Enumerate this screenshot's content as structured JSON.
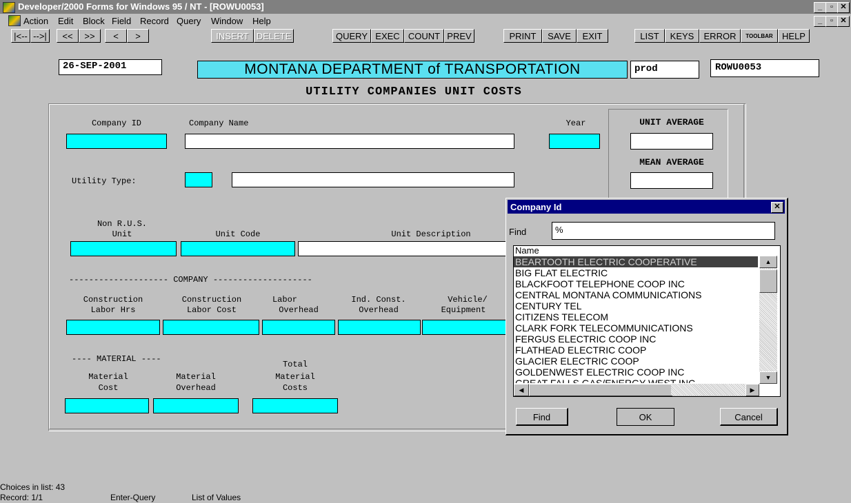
{
  "window": {
    "title": "Developer/2000 Forms for Windows 95 / NT  - [ROWU0053]"
  },
  "menu": [
    "Action",
    "Edit",
    "Block",
    "Field",
    "Record",
    "Query",
    "Window",
    "Help"
  ],
  "toolbar": {
    "first": "|<--",
    "last": "-->|",
    "prev_set": "<<",
    "next_set": ">>",
    "prev": "<",
    "next": ">",
    "insert": "INSERT",
    "delete": "DELETE",
    "query": "QUERY",
    "exec": "EXEC",
    "count": "COUNT",
    "prev_q": "PREV",
    "print": "PRINT",
    "save": "SAVE",
    "exit": "EXIT",
    "list": "LIST",
    "keys": "KEYS",
    "error": "ERROR",
    "toolbar": "TOOLBAR",
    "help": "HELP"
  },
  "header": {
    "date": "26-SEP-2001",
    "department": "MONTANA DEPARTMENT of TRANSPORTATION",
    "env": "prod",
    "form_id": "ROWU0053",
    "form_title": "UTILITY COMPANIES UNIT COSTS"
  },
  "form": {
    "company_id_label": "Company ID",
    "company_name_label": "Company Name",
    "year_label": "Year",
    "unit_average_label": "UNIT AVERAGE",
    "mean_average_label": "MEAN AVERAGE",
    "utility_type_label": "Utility Type:",
    "non_rus_label_1": "Non R.U.S.",
    "non_rus_label_2": "Unit",
    "unit_code_label": "Unit Code",
    "unit_description_label": "Unit Description",
    "company_section": "-------------------- COMPANY --------------------",
    "construction_labor_hrs_1": "Construction",
    "construction_labor_hrs_2": "Labor Hrs",
    "construction_labor_cost_1": "Construction",
    "construction_labor_cost_2": "Labor Cost",
    "labor_overhead_1": "Labor",
    "labor_overhead_2": "Overhead",
    "ind_const_overhead_1": "Ind. Const.",
    "ind_const_overhead_2": "Overhead",
    "vehicle_equipment_1": "Vehicle/",
    "vehicle_equipment_2": "Equipment",
    "material_section": "---- MATERIAL ----",
    "material_cost_1": "Material",
    "material_cost_2": "Cost",
    "material_overhead_1": "Material",
    "material_overhead_2": "Overhead",
    "total_material_1": "Total",
    "total_material_2": "Material",
    "total_material_3": "Costs"
  },
  "lov": {
    "title": "Company Id",
    "find_label": "Find",
    "find_value": "%",
    "column_header": "Name",
    "items": [
      "BEARTOOTH ELECTRIC COOPERATIVE",
      "BIG FLAT ELECTRIC",
      "BLACKFOOT TELEPHONE COOP INC",
      "CENTRAL MONTANA COMMUNICATIONS",
      "CENTURY TEL",
      "CITIZENS TELECOM",
      "CLARK FORK TELECOMMUNICATIONS",
      "FERGUS ELECTRIC COOP INC",
      "FLATHEAD ELECTRIC COOP",
      "GLACIER ELECTRIC COOP",
      "GOLDENWEST ELECTRIC COOP INC",
      "GREAT FALLS GAS/ENERGY WEST INC"
    ],
    "find_button": "Find",
    "ok_button": "OK",
    "cancel_button": "Cancel"
  },
  "status": {
    "choices": "Choices in list: 43",
    "record": "Record: 1/1",
    "mode": "Enter-Query",
    "context": "List of Values"
  },
  "colors": {
    "field": "#00ffff",
    "titlebar": "#808080",
    "dialog_caption": "#000080",
    "selected": "#404040"
  }
}
